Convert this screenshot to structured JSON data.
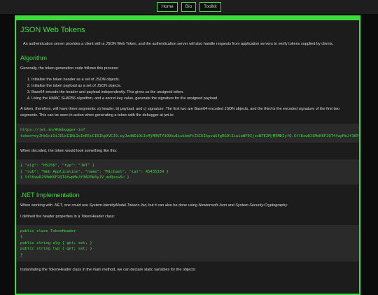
{
  "nav": {
    "items": [
      "Home",
      "Bio",
      "Toolkit"
    ]
  },
  "page": {
    "title": "JSON Web Tokens",
    "intro": "An authentication server provides a client with a JSON Web Token, and the authentication server will also handle requests from application servers to verify tokens supplied by clients.",
    "algorithm": {
      "heading": "Algorithm",
      "lead": "Generally, the token generation code follows this process:",
      "steps": [
        "Initialise the token header as a set of JSON objects.",
        "Initialise the token payload as a set of JSON objects.",
        "Base64-encode the header and payload independently. This gives us the unsigned token.",
        "Using the HMAC SHA256 algorithm, and a secret key value, generate the signature for the unsigned payload."
      ],
      "segments_text": "A token, therefore, will have three segments: a) header, b) payload, and c) signature. The first two are Base64-encoded JSON objects, and the third is the encoded signature of the first two segments. This can be seen in action when generating a token with the debugger at jwt.io:",
      "url_code": "https://jwt.io/#debugger-io?\ntoken=eyJhbGciOiJIUzI1NiIsInR5cCI6IkpXVCJ9.eyJzdWIiOiIxMjM0NTY3ODkwIiwibmFtZSI6IkpvaG4gRG9lIiwiaWF0IjoxNTE2MjM5MDIyfQ.SflKxwRJSMeKKF2QT4fwpMeJf36POk6yJV_adQssw5c",
      "decoded_lead": "When decoded, the token would look something like this:",
      "decoded_code": "{ \"alg\": \"HS256\", \"typ\": \"JWT\" }\n{ \"sub\": \"Web Application\", \"name\": \"Michael\", \"iat\": 45435334 }\n{ SflKxwRJSMeKKF2QT4fwpMeJf36POk6yJV_adQssw5c }"
    },
    "net": {
      "heading": ".NET Implementation",
      "p1_a": "When working with .NET, one could use ",
      "p1_em1": "System.IdentityModel.Tokens.Jwt",
      "p1_b": ", but it can also be done using ",
      "p1_em2": "Newtonsoft.Json",
      "p1_c": " and ",
      "p1_em3": "System.Security.Cryptography",
      "p1_d": ".",
      "p2": "I defined the header properties in a TokenHeader class:",
      "class_code": "public class TokenHeader\n{\npublic string alg { get; set; }\npublic string typ { get; set; }\n}",
      "p3": "Instantiating the TokenHeader class in the main method, we can declare static variables for the objects:"
    }
  }
}
